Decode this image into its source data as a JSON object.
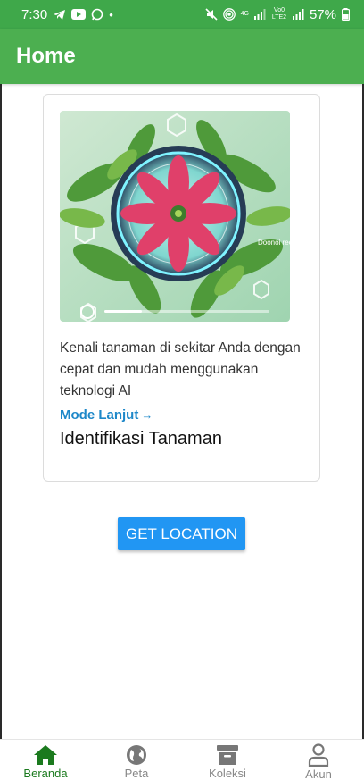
{
  "status_bar": {
    "time": "7:30",
    "battery": "57%",
    "network_small": "4G",
    "volte_small": "Vo0 LTE2"
  },
  "app_bar": {
    "title": "Home"
  },
  "card": {
    "image_overlay_text": "Doonoi recatic",
    "description": "Kenali tanaman di sekitar Anda dengan cepat dan mudah menggunakan teknologi AI",
    "link_label": "Mode Lanjut",
    "title": "Identifikasi Tanaman"
  },
  "location_button": {
    "label": "GET LOCATION"
  },
  "bottom_nav": {
    "items": [
      {
        "label": "Beranda",
        "icon": "home-icon",
        "active": true
      },
      {
        "label": "Peta",
        "icon": "globe-icon",
        "active": false
      },
      {
        "label": "Koleksi",
        "icon": "archive-icon",
        "active": false
      },
      {
        "label": "Akun",
        "icon": "user-icon",
        "active": false
      }
    ]
  },
  "colors": {
    "primary": "#4caf50",
    "status_bar": "#3fa84a",
    "button": "#2196f3",
    "link": "#1e88c9",
    "nav_active": "#1b7a1e"
  }
}
